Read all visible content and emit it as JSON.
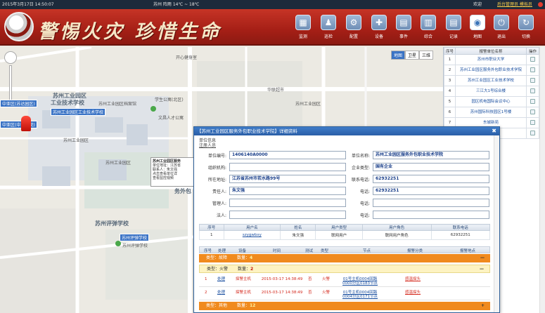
{
  "status": {
    "datetime": "2015年3月17日 14:50:07",
    "weather": "苏州  阵雨  14℃ ~ 18℃",
    "welcome": "欢迎",
    "user": "后台管理员 模拟员"
  },
  "header": {
    "slogan": "警惕火灾  珍惜生命",
    "nav": [
      {
        "label": "监测",
        "icon": "monitor-icon",
        "glyph": "▦"
      },
      {
        "label": "巡检",
        "icon": "patrol-icon",
        "glyph": "♟"
      },
      {
        "label": "配置",
        "icon": "config-icon",
        "glyph": "⚙"
      },
      {
        "label": "设备",
        "icon": "device-icon",
        "glyph": "✚"
      },
      {
        "label": "事件",
        "icon": "event-icon",
        "glyph": "▤"
      },
      {
        "label": "综合",
        "icon": "general-icon",
        "glyph": "▥"
      },
      {
        "label": "记录",
        "icon": "record-icon",
        "glyph": "▤"
      },
      {
        "label": "地图",
        "icon": "map-icon",
        "glyph": "◉"
      },
      {
        "label": "退出",
        "icon": "power-icon",
        "glyph": "⏻"
      },
      {
        "label": "切换",
        "icon": "switch-icon",
        "glyph": "↻"
      }
    ]
  },
  "map": {
    "labels": [
      "苏州工业园区",
      "工业技术学校",
      "苏州工业园区服务",
      "苏州评弹学校",
      "苏州评弹学校",
      "学生公寓(北区)",
      "文昌人才公寓",
      "苏州工业园区档案馆",
      "苏州工业园区",
      "苏州工业园区",
      "苏州工业园区",
      "开心健身室",
      "华联超市",
      "苏州工业园区",
      "务外包",
      "苏州工"
    ],
    "tags": [
      "苏州工业园区工业技术学校",
      "中亚区(苏达园区)",
      "中亚区(中亚学院)",
      "苏州评弹学校"
    ],
    "types": [
      "地图",
      "卫星",
      "三维"
    ],
    "popup": {
      "title": "苏州工业园区服务",
      "lines": [
        "单位地址：江苏省",
        "联系人：朱文强",
        "点击查看单位详",
        "查看监控视频"
      ]
    }
  },
  "unit_list": {
    "headers": [
      "序号",
      "报警单位名称",
      "操作"
    ],
    "rows": [
      {
        "idx": "1",
        "name": "苏州市职业大学"
      },
      {
        "idx": "2",
        "name": "苏州工业园区服务外包职业技术学院"
      },
      {
        "idx": "3",
        "name": "苏州工业园区工业技术学校"
      },
      {
        "idx": "4",
        "name": "三江大1号综合楼"
      },
      {
        "idx": "5",
        "name": "园区机电国际会议中心"
      },
      {
        "idx": "6",
        "name": "苏州国际科技园区1号楼"
      },
      {
        "idx": "7",
        "name": "东城新苑"
      },
      {
        "idx": "8",
        "name": ""
      }
    ]
  },
  "dialog": {
    "title": "【苏州工业园区服务外包职业技术学院】详细资料",
    "section": "单位信息",
    "subsection": "注册人员",
    "fields_left": [
      {
        "label": "单位编号:",
        "value": "1406140A0000"
      },
      {
        "label": "组织机构:",
        "value": ""
      },
      {
        "label": "所在地址:",
        "value": "江苏省苏州市若水路99号"
      },
      {
        "label": "责任人:",
        "value": "朱文强"
      },
      {
        "label": "管理人:",
        "value": ""
      },
      {
        "label": "法人:",
        "value": ""
      }
    ],
    "fields_right": [
      {
        "label": "单位名称:",
        "value": "苏州工业园区服务外包职业技术学院"
      },
      {
        "label": "企业类型:",
        "value": "国有企业"
      },
      {
        "label": "联系电话:",
        "value": "62932251"
      },
      {
        "label": "电话:",
        "value": "62932251"
      },
      {
        "label": "电话:",
        "value": ""
      },
      {
        "label": "电话:",
        "value": ""
      }
    ],
    "user_table": {
      "headers": [
        "序号",
        "用户名",
        "姓名",
        "用户类型",
        "用户角色",
        "联系电话"
      ],
      "rows": [
        [
          "1",
          "szygwbxy",
          "朱文强",
          "联网用户",
          "联网用户角色",
          "62932251"
        ]
      ]
    },
    "alarm_headers": [
      "序号",
      "处理",
      "设备",
      "时间",
      "测试",
      "类型",
      "节点",
      "报警分类",
      "报警地点"
    ],
    "groups": [
      {
        "type_label": "类型：故障",
        "count_label": "数量：",
        "count": "4",
        "toggle": "—"
      },
      {
        "type_label": "类型：火警",
        "count_label": "数量：",
        "count": "2",
        "toggle": "—"
      }
    ],
    "alarms": [
      {
        "idx": "1",
        "op": "处理",
        "device": "探警主机",
        "time": "2015-03-17 14:38:49",
        "test": "否",
        "type": "火警",
        "node": "01号主机0004回路0000分区0183节点",
        "category": "感温探头"
      },
      {
        "idx": "2",
        "op": "处理",
        "device": "探警主机",
        "time": "2015-03-17 14:38:49",
        "test": "否",
        "type": "火警",
        "node": "01号主机0004回路0004分区0171节点",
        "category": "感温探头"
      }
    ],
    "group_bottom": {
      "type_label": "类型：其他",
      "count_label": "数量：",
      "count": "12",
      "toggle": "+"
    }
  }
}
